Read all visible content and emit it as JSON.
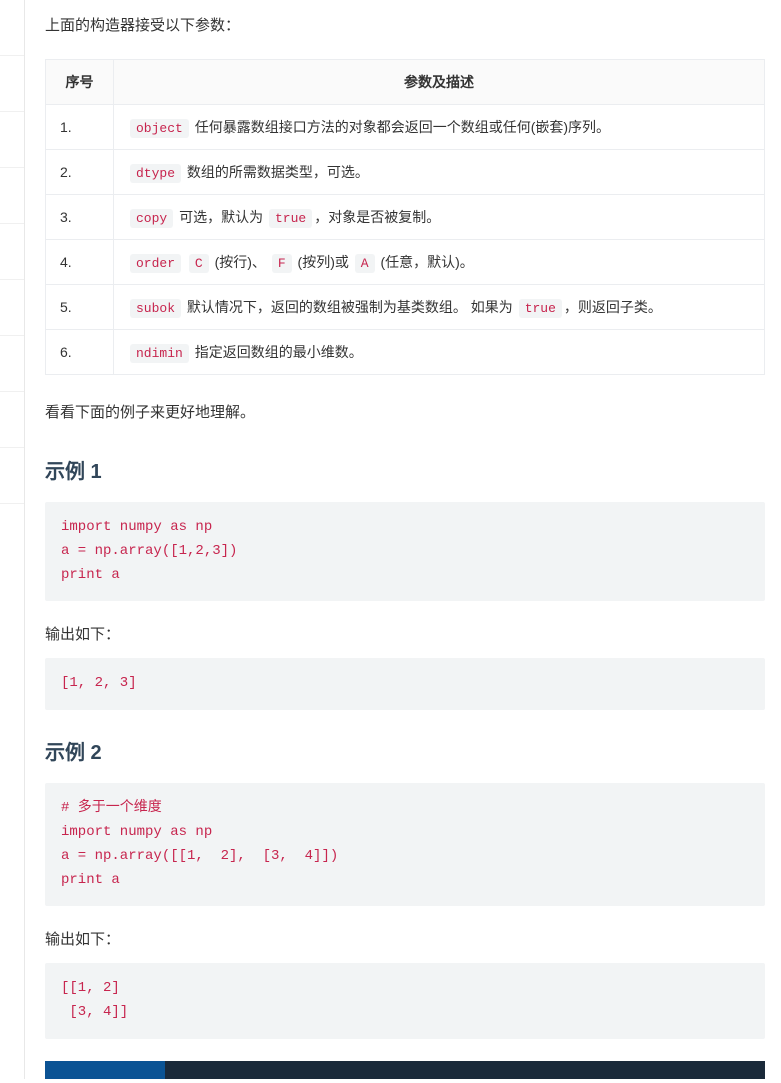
{
  "intro": "上面的构造器接受以下参数：",
  "table": {
    "header_seq": "序号",
    "header_desc": "参数及描述",
    "rows": [
      {
        "seq": "1.",
        "code": "object",
        "t1": " 任何暴露数组接口方法的对象都会返回一个数组或任何(嵌套)序列。"
      },
      {
        "seq": "2.",
        "code": "dtype",
        "t1": " 数组的所需数据类型，可选。"
      },
      {
        "seq": "3.",
        "code": "copy",
        "t1": " 可选，默认为 ",
        "code2": "true",
        "t2": "，对象是否被复制。"
      },
      {
        "seq": "4.",
        "code": "order",
        "t1": " ",
        "code2": "C",
        "t2": " (按行)、 ",
        "code3": "F",
        "t3": " (按列)或 ",
        "code4": "A",
        "t4": " (任意，默认)。"
      },
      {
        "seq": "5.",
        "code": "subok",
        "t1": " 默认情况下，返回的数组被强制为基类数组。 如果为 ",
        "code2": "true",
        "t2": "，则返回子类。"
      },
      {
        "seq": "6.",
        "code": "ndimin",
        "t1": " 指定返回数组的最小维数。"
      }
    ]
  },
  "after_table": "看看下面的例子来更好地理解。",
  "ex1": {
    "title": "示例 1",
    "code": "import numpy as np \na = np.array([1,2,3])  \nprint a",
    "outlabel": "输出如下：",
    "output": "[1, 2, 3]"
  },
  "ex2": {
    "title": "示例 2",
    "code": "# 多于一个维度  \nimport numpy as np \na = np.array([[1,  2],  [3,  4]])  \nprint a",
    "outlabel": "输出如下：",
    "output": "[[1, 2] \n [3, 4]]"
  }
}
